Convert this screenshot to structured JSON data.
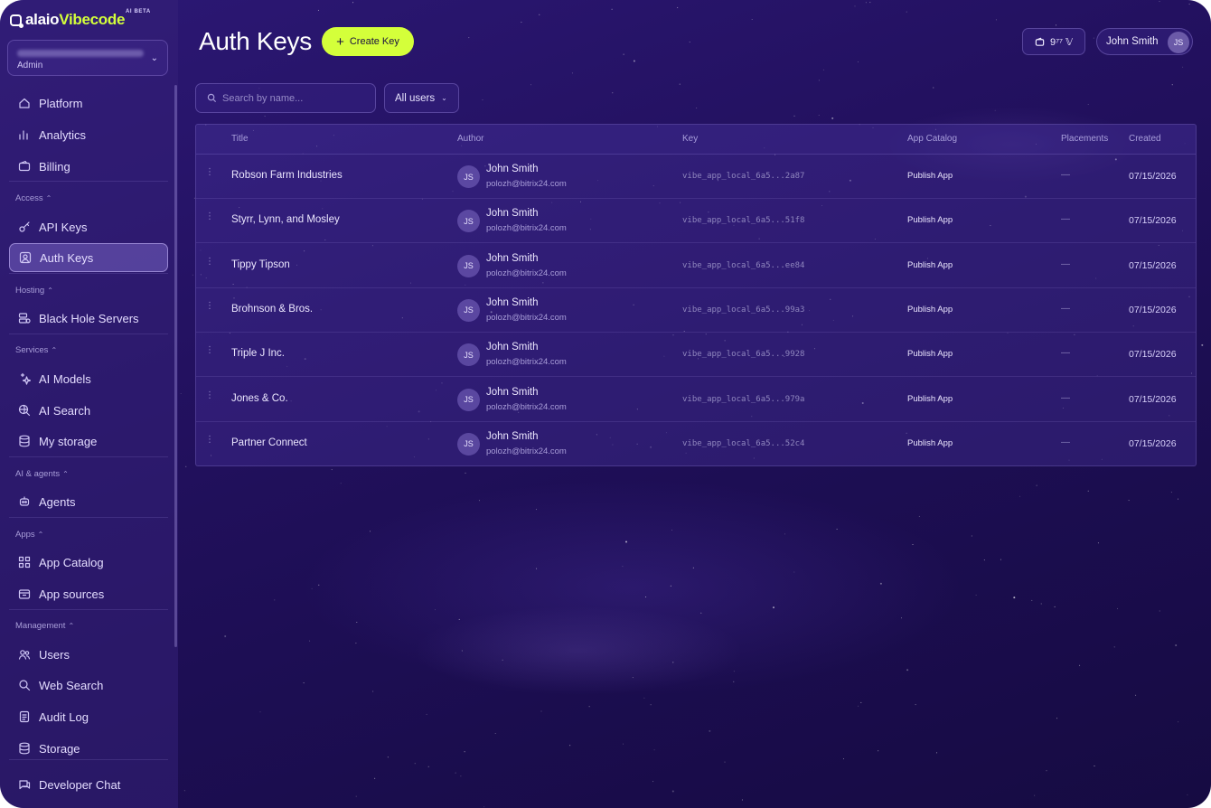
{
  "brand": {
    "prefix": "alaio",
    "name": "Vibecode",
    "badge": "AI BETA"
  },
  "org": {
    "role": "Admin"
  },
  "sidebar": {
    "items": [
      {
        "label": "Platform",
        "icon": "home-icon"
      },
      {
        "label": "Analytics",
        "icon": "bar-chart-icon"
      },
      {
        "label": "Billing",
        "icon": "wallet-icon"
      },
      {
        "label": "API Keys",
        "icon": "key-icon"
      },
      {
        "label": "Auth Keys",
        "icon": "auth-key-icon",
        "active": true
      },
      {
        "label": "Black Hole Servers",
        "icon": "server-icon"
      },
      {
        "label": "AI Models",
        "icon": "sparkles-icon"
      },
      {
        "label": "AI Search",
        "icon": "globe-search-icon"
      },
      {
        "label": "My storage",
        "icon": "database-icon"
      },
      {
        "label": "Agents",
        "icon": "agent-icon"
      },
      {
        "label": "App Catalog",
        "icon": "grid-icon"
      },
      {
        "label": "App sources",
        "icon": "package-icon"
      },
      {
        "label": "Users",
        "icon": "users-icon"
      },
      {
        "label": "Web Search",
        "icon": "search-icon"
      },
      {
        "label": "Audit Log",
        "icon": "document-icon"
      },
      {
        "label": "Storage",
        "icon": "database-icon"
      },
      {
        "label": "Developer Chat",
        "icon": "chat-icon"
      }
    ],
    "sections": [
      "Access",
      "Hosting",
      "Services",
      "AI & agents",
      "Apps",
      "Management"
    ]
  },
  "header": {
    "title": "Auth Keys",
    "create_label": "Create Key",
    "balance": "9⁷⁷ 𝕍",
    "user_name": "John Smith",
    "user_initials": "JS"
  },
  "filters": {
    "search_placeholder": "Search by name...",
    "users_select": "All users"
  },
  "table": {
    "columns": [
      "Title",
      "Author",
      "Key",
      "App Catalog",
      "Placements",
      "Created"
    ],
    "rows": [
      {
        "title": "Robson Farm Industries",
        "author": "John Smith",
        "email": "polozh@bitrix24.com",
        "initials": "JS",
        "key": "vibe_app_local_6a5...2a87",
        "catalog": "Publish App",
        "placements": "—",
        "created": "07/15/2026"
      },
      {
        "title": "Styrr, Lynn, and Mosley",
        "author": "John Smith",
        "email": "polozh@bitrix24.com",
        "initials": "JS",
        "key": "vibe_app_local_6a5...51f8",
        "catalog": "Publish App",
        "placements": "—",
        "created": "07/15/2026"
      },
      {
        "title": "Tippy Tipson",
        "author": "John Smith",
        "email": "polozh@bitrix24.com",
        "initials": "JS",
        "key": "vibe_app_local_6a5...ee84",
        "catalog": "Publish App",
        "placements": "—",
        "created": "07/15/2026"
      },
      {
        "title": "Brohnson & Bros.",
        "author": "John Smith",
        "email": "polozh@bitrix24.com",
        "initials": "JS",
        "key": "vibe_app_local_6a5...99a3",
        "catalog": "Publish App",
        "placements": "—",
        "created": "07/15/2026"
      },
      {
        "title": "Triple J Inc.",
        "author": "John Smith",
        "email": "polozh@bitrix24.com",
        "initials": "JS",
        "key": "vibe_app_local_6a5...9928",
        "catalog": "Publish App",
        "placements": "—",
        "created": "07/15/2026"
      },
      {
        "title": "Jones & Co.",
        "author": "John Smith",
        "email": "polozh@bitrix24.com",
        "initials": "JS",
        "key": "vibe_app_local_6a5...979a",
        "catalog": "Publish App",
        "placements": "—",
        "created": "07/15/2026"
      },
      {
        "title": "Partner Connect",
        "author": "John Smith",
        "email": "polozh@bitrix24.com",
        "initials": "JS",
        "key": "vibe_app_local_6a5...52c4",
        "catalog": "Publish App",
        "placements": "—",
        "created": "07/15/2026"
      }
    ]
  },
  "colors": {
    "accent": "#d4ff3a",
    "background": "#231160",
    "sidebar": "#2e1a78"
  }
}
